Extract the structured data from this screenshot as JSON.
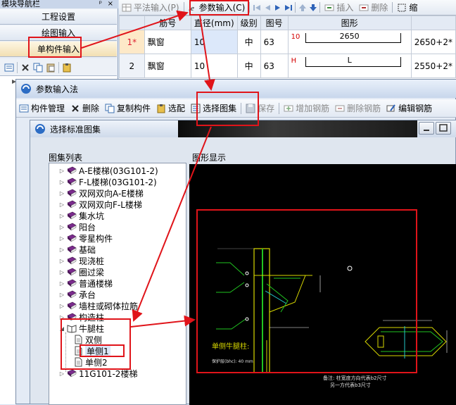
{
  "nav": {
    "title": "模块导航栏",
    "pin": "ᵖ",
    "close": "×",
    "buttons": [
      "工程设置",
      "绘图输入",
      "单构件输入"
    ]
  },
  "toolbar": {
    "plane_input": "平法输入(P)",
    "param_input": "参数输入(C)",
    "insert": "插入",
    "delete": "删除",
    "trailing": "缩"
  },
  "table": {
    "headers": [
      "",
      "筋号",
      "直径(mm)",
      "级别",
      "图号",
      "图形",
      ""
    ],
    "rows": [
      {
        "no": "1*",
        "name": "飘窗",
        "dia": "10",
        "grade": "中",
        "fig": "63",
        "mark": "10",
        "shape_label": "2650",
        "calc": "2650+2*"
      },
      {
        "no": "2",
        "name": "飘窗",
        "dia": "10",
        "grade": "中",
        "fig": "63",
        "mark": "H",
        "shape_label": "L",
        "calc": "2550+2*"
      }
    ]
  },
  "dialog1": {
    "title": "参数输入法",
    "toolbar": {
      "manage": "构件管理",
      "delete": "删除",
      "copy": "复制构件",
      "match": "选配",
      "select_atlas": "选择图集",
      "save": "保存",
      "add_rebar": "增加钢筋",
      "del_rebar": "删除钢筋",
      "edit_rebar": "编辑钢筋"
    }
  },
  "dialog2": {
    "title": "选择标准图集",
    "list_label": "图集列表",
    "display_label": "图形显示",
    "tree": [
      {
        "label": "A-E楼梯(03G101-2)",
        "level": 0,
        "type": "book",
        "state": "collapsed"
      },
      {
        "label": "F-L楼梯(03G101-2)",
        "level": 0,
        "type": "book",
        "state": "collapsed"
      },
      {
        "label": "双网双向A-E楼梯",
        "level": 0,
        "type": "book",
        "state": "collapsed"
      },
      {
        "label": "双网双向F-L楼梯",
        "level": 0,
        "type": "book",
        "state": "collapsed"
      },
      {
        "label": "集水坑",
        "level": 0,
        "type": "book",
        "state": "collapsed"
      },
      {
        "label": "阳台",
        "level": 0,
        "type": "book",
        "state": "collapsed"
      },
      {
        "label": "零星构件",
        "level": 0,
        "type": "book",
        "state": "collapsed"
      },
      {
        "label": "基础",
        "level": 0,
        "type": "book",
        "state": "collapsed"
      },
      {
        "label": "现浇桩",
        "level": 0,
        "type": "book",
        "state": "collapsed"
      },
      {
        "label": "圈过梁",
        "level": 0,
        "type": "book",
        "state": "collapsed"
      },
      {
        "label": "普通楼梯",
        "level": 0,
        "type": "book",
        "state": "collapsed"
      },
      {
        "label": "承台",
        "level": 0,
        "type": "book",
        "state": "collapsed"
      },
      {
        "label": "墙柱或砌体拉筋",
        "level": 0,
        "type": "book",
        "state": "collapsed"
      },
      {
        "label": "构造柱",
        "level": 0,
        "type": "book",
        "state": "collapsed"
      },
      {
        "label": "牛腿柱",
        "level": 0,
        "type": "open-book",
        "state": "expanded"
      },
      {
        "label": "双侧",
        "level": 1,
        "type": "page",
        "state": "leaf"
      },
      {
        "label": "单侧1",
        "level": 1,
        "type": "page",
        "state": "selected"
      },
      {
        "label": "单侧2",
        "level": 1,
        "type": "page",
        "state": "leaf"
      },
      {
        "label": "11G101-2楼梯",
        "level": 0,
        "type": "book",
        "state": "collapsed"
      }
    ],
    "drawing": {
      "title": "单侧牛腿柱:",
      "cover": "保护层(bhc): 40 mm",
      "note1": "备注: 柱宽度方向代表b2尺寸",
      "note2": "另一方代表b3尺寸"
    }
  },
  "colors": {
    "annotation": "#e0141a",
    "book": "#7a2b8c",
    "cad_line": "#d8d800",
    "cad_green": "#21c321",
    "cad_cyan": "#22c8c8"
  }
}
